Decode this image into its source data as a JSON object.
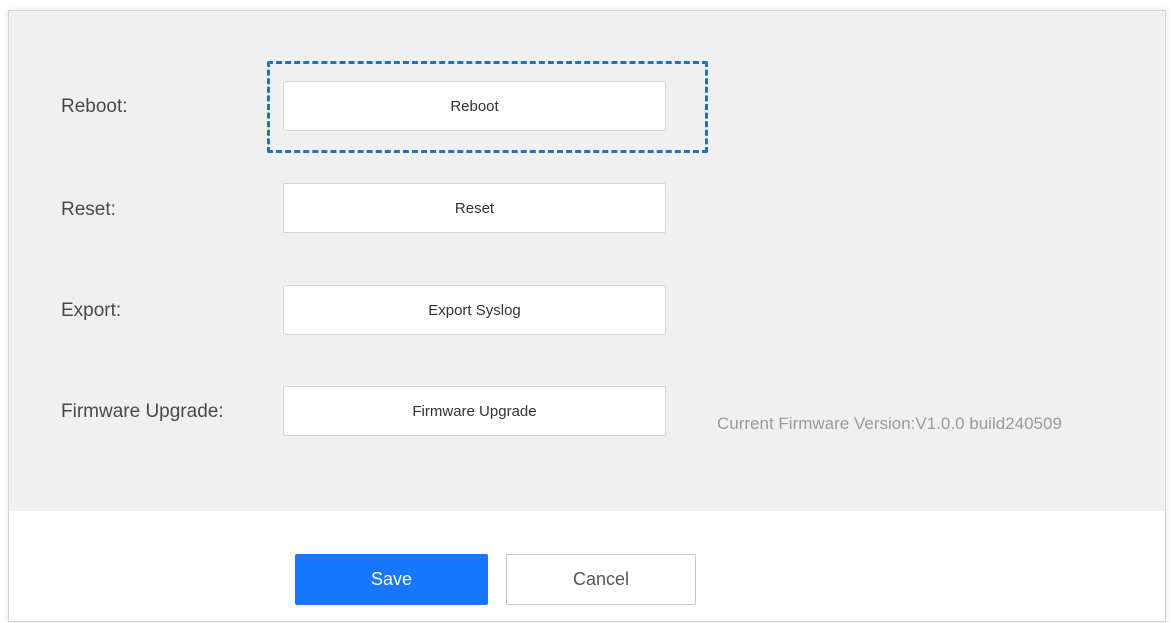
{
  "rows": [
    {
      "label": "Reboot:",
      "button": "Reboot"
    },
    {
      "label": "Reset:",
      "button": "Reset"
    },
    {
      "label": "Export:",
      "button": "Export Syslog"
    },
    {
      "label": "Firmware Upgrade:",
      "button": "Firmware Upgrade"
    }
  ],
  "firmware": {
    "current_version": "Current Firmware Version:V1.0.0 build240509"
  },
  "footer": {
    "save_label": "Save",
    "cancel_label": "Cancel"
  },
  "colors": {
    "primary": "#1677ff",
    "highlight": "#1e73be",
    "content_background": "#f0f0f0"
  }
}
